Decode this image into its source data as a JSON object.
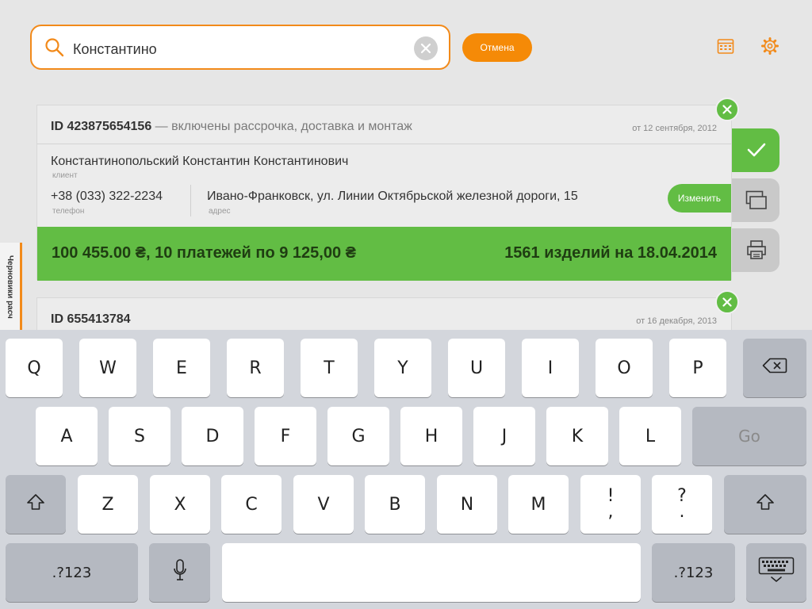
{
  "search": {
    "value": "Константино"
  },
  "header": {
    "cancel_label": "Отмена"
  },
  "side_tab": {
    "label": "Черновики расч"
  },
  "cards": [
    {
      "id": "ID 423875654156",
      "desc": " — включены рассрочка, доставка и монтаж",
      "date": "от 12 сентября, 2012",
      "client_name": "Константинопольский Константин Константинович",
      "client_caption": "клиент",
      "phone": "+38 (033) 322-2234",
      "phone_caption": "телефон",
      "address": "Ивано-Франковск, ул. Линии Октябрьской железной дороги, 15",
      "address_caption": "адрес",
      "edit_label": "Изменить",
      "summary_left": "100 455.00 ₴, 10 платежей по 9 125,00 ₴",
      "summary_right": "1561 изделий на 18.04.2014"
    },
    {
      "id": "ID 655413784",
      "date": "от 16 декабря, 2013"
    }
  ],
  "keyboard": {
    "row1": [
      "Q",
      "W",
      "E",
      "R",
      "T",
      "Y",
      "U",
      "I",
      "O",
      "P"
    ],
    "row2": [
      "A",
      "S",
      "D",
      "F",
      "G",
      "H",
      "J",
      "K",
      "L"
    ],
    "row3": [
      "Z",
      "X",
      "C",
      "V",
      "B",
      "N",
      "M"
    ],
    "go_label": "Go",
    "excl": "!",
    "comma": ",",
    "question": "?",
    "period": ".",
    "numbers_label": ".?123"
  },
  "colors": {
    "orange": "#f58a07",
    "green": "#62bd44"
  },
  "icons": [
    "search-icon",
    "clear-icon",
    "calendar-icon",
    "gear-icon",
    "checkmark-icon",
    "layers-icon",
    "printer-icon",
    "close-icon",
    "backspace-icon",
    "shift-icon",
    "microphone-icon",
    "keyboard-hide-icon"
  ]
}
